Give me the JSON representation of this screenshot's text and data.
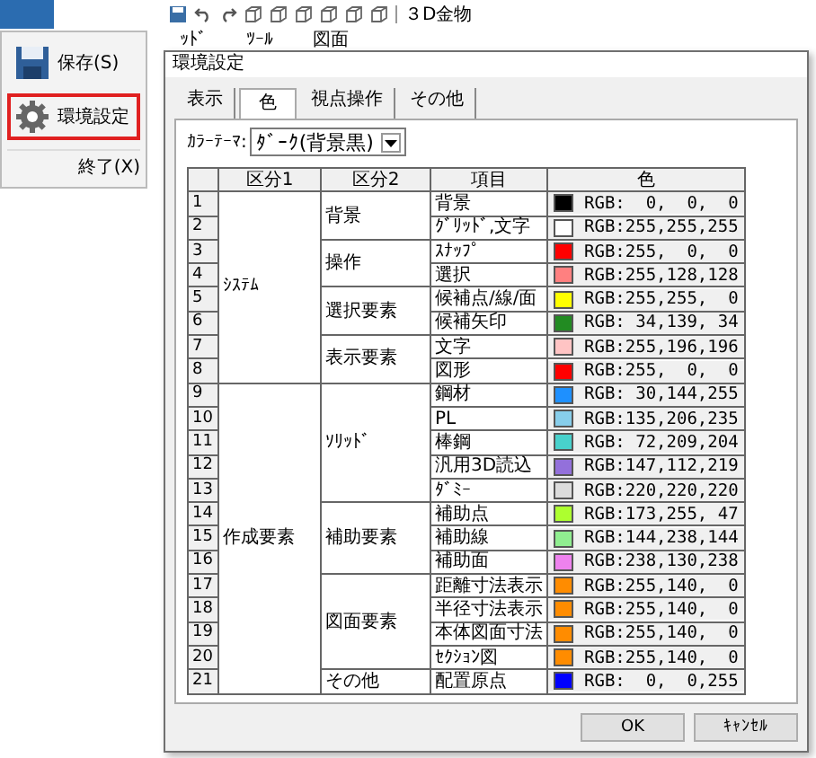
{
  "app": {
    "toolbar_title": "３D金物",
    "ribbon_tabs": [
      "ｯﾄﾞ",
      "ﾂｰﾙ",
      "図面"
    ],
    "menu": [
      {
        "label": "保存(S)",
        "kind": "save",
        "selected": false
      },
      {
        "label": "環境設定",
        "kind": "settings",
        "selected": true
      }
    ],
    "exit": "終了(X)"
  },
  "dialog": {
    "title": "環境設定",
    "tabs": [
      {
        "label": "表示",
        "selected": false
      },
      {
        "label": "色",
        "selected": true
      },
      {
        "label": "視点操作",
        "selected": false
      },
      {
        "label": "その他",
        "selected": false
      }
    ],
    "theme_label": "ｶﾗｰﾃｰﾏ:",
    "theme_value": "ﾀﾞｰｸ(背景黒)",
    "columns": [
      "区分1",
      "区分2",
      "項目",
      "色"
    ],
    "categories": [
      {
        "name": "ｼｽﾃﾑ",
        "groups": [
          {
            "name": "背景",
            "items": [
              {
                "no": "1",
                "name": "背景",
                "color": "#000000",
                "rgb": "RGB:  0,  0,  0"
              },
              {
                "no": "2",
                "name": "ｸﾞﾘｯﾄﾞ,文字",
                "color": "#ffffff",
                "rgb": "RGB:255,255,255"
              }
            ]
          },
          {
            "name": "操作",
            "items": [
              {
                "no": "3",
                "name": "ｽﾅｯﾌﾟ",
                "color": "#ff0000",
                "rgb": "RGB:255,  0,  0"
              },
              {
                "no": "4",
                "name": "選択",
                "color": "#ff8080",
                "rgb": "RGB:255,128,128"
              }
            ]
          },
          {
            "name": "選択要素",
            "items": [
              {
                "no": "5",
                "name": "候補点/線/面",
                "color": "#ffff00",
                "rgb": "RGB:255,255,  0"
              },
              {
                "no": "6",
                "name": "候補矢印",
                "color": "#228b22",
                "rgb": "RGB: 34,139, 34"
              }
            ]
          },
          {
            "name": "表示要素",
            "items": [
              {
                "no": "7",
                "name": "文字",
                "color": "#ffc4c4",
                "rgb": "RGB:255,196,196"
              },
              {
                "no": "8",
                "name": "図形",
                "color": "#ff0000",
                "rgb": "RGB:255,  0,  0"
              }
            ]
          }
        ]
      },
      {
        "name": "作成要素",
        "groups": [
          {
            "name": "ｿﾘｯﾄﾞ",
            "items": [
              {
                "no": "9",
                "name": "鋼材",
                "color": "#1e90ff",
                "rgb": "RGB: 30,144,255"
              },
              {
                "no": "10",
                "name": "PL",
                "color": "#87ceeb",
                "rgb": "RGB:135,206,235"
              },
              {
                "no": "11",
                "name": "棒鋼",
                "color": "#48d1cc",
                "rgb": "RGB: 72,209,204"
              },
              {
                "no": "12",
                "name": "汎用3D読込",
                "color": "#9370db",
                "rgb": "RGB:147,112,219"
              },
              {
                "no": "13",
                "name": "ﾀﾞﾐｰ",
                "color": "#dcdcdc",
                "rgb": "RGB:220,220,220"
              }
            ]
          },
          {
            "name": "補助要素",
            "items": [
              {
                "no": "14",
                "name": "補助点",
                "color": "#adff2f",
                "rgb": "RGB:173,255, 47"
              },
              {
                "no": "15",
                "name": "補助線",
                "color": "#90ee90",
                "rgb": "RGB:144,238,144"
              },
              {
                "no": "16",
                "name": "補助面",
                "color": "#ee82ee",
                "rgb": "RGB:238,130,238"
              }
            ]
          },
          {
            "name": "図面要素",
            "items": [
              {
                "no": "17",
                "name": "距離寸法表示",
                "color": "#ff8c00",
                "rgb": "RGB:255,140,  0"
              },
              {
                "no": "18",
                "name": "半径寸法表示",
                "color": "#ff8c00",
                "rgb": "RGB:255,140,  0"
              },
              {
                "no": "19",
                "name": "本体図面寸法",
                "color": "#ff8c00",
                "rgb": "RGB:255,140,  0"
              },
              {
                "no": "20",
                "name": "ｾｸｼｮﾝ図",
                "color": "#ff8c00",
                "rgb": "RGB:255,140,  0"
              }
            ]
          },
          {
            "name": "その他",
            "items": [
              {
                "no": "21",
                "name": "配置原点",
                "color": "#0000ff",
                "rgb": "RGB:  0,  0,255"
              }
            ]
          }
        ]
      }
    ],
    "buttons": [
      "OK",
      "ｷｬﾝｾﾙ"
    ]
  }
}
